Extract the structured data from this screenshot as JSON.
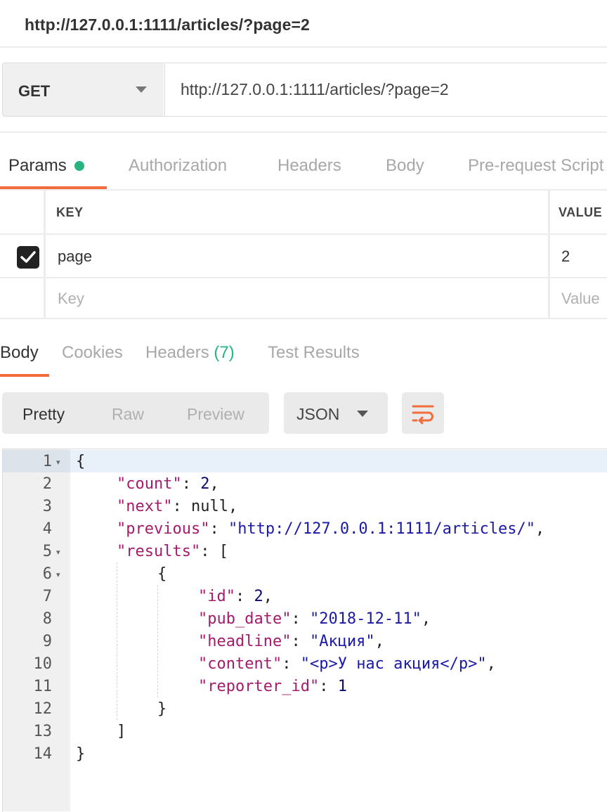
{
  "window": {
    "title": "http://127.0.0.1:1111/articles/?page=2"
  },
  "request": {
    "method": "GET",
    "url": "http://127.0.0.1:1111/articles/?page=2"
  },
  "request_tabs": [
    {
      "label": "Params",
      "active": true,
      "has_indicator": true
    },
    {
      "label": "Authorization",
      "active": false
    },
    {
      "label": "Headers",
      "active": false
    },
    {
      "label": "Body",
      "active": false
    },
    {
      "label": "Pre-request Script",
      "active": false
    }
  ],
  "params": {
    "headers": {
      "key": "KEY",
      "value": "VALUE"
    },
    "rows": [
      {
        "checked": true,
        "key": "page",
        "value": "2"
      }
    ],
    "placeholder": {
      "key": "Key",
      "value": "Value"
    }
  },
  "response_tabs": [
    {
      "label": "Body",
      "active": true
    },
    {
      "label": "Cookies",
      "active": false
    },
    {
      "label": "Headers",
      "count": "(7)",
      "active": false
    },
    {
      "label": "Test Results",
      "active": false
    }
  ],
  "view_modes": [
    {
      "label": "Pretty",
      "active": true
    },
    {
      "label": "Raw",
      "active": false
    },
    {
      "label": "Preview",
      "active": false
    }
  ],
  "format": {
    "selected": "JSON"
  },
  "icons": {
    "dropdown": "chevron-down-icon",
    "wrap": "wrap-lines-icon",
    "check": "check-icon"
  },
  "colors": {
    "accent": "#f26b3a",
    "indicator": "#26b47f",
    "json_key": "#a11d6c",
    "json_string": "#1a1aa6"
  },
  "code": {
    "line_numbers": [
      "1",
      "2",
      "3",
      "4",
      "5",
      "6",
      "7",
      "8",
      "9",
      "10",
      "11",
      "12",
      "13",
      "14"
    ],
    "lines": [
      {
        "indent": 0,
        "tokens": [
          {
            "t": "p",
            "v": "{"
          }
        ]
      },
      {
        "indent": 1,
        "tokens": [
          {
            "t": "k",
            "v": "\"count\""
          },
          {
            "t": "p",
            "v": ": "
          },
          {
            "t": "n",
            "v": "2"
          },
          {
            "t": "p",
            "v": ","
          }
        ]
      },
      {
        "indent": 1,
        "tokens": [
          {
            "t": "k",
            "v": "\"next\""
          },
          {
            "t": "p",
            "v": ": "
          },
          {
            "t": "p",
            "v": "null"
          },
          {
            "t": "p",
            "v": ","
          }
        ]
      },
      {
        "indent": 1,
        "tokens": [
          {
            "t": "k",
            "v": "\"previous\""
          },
          {
            "t": "p",
            "v": ": "
          },
          {
            "t": "s",
            "v": "\"http://127.0.0.1:1111/articles/\""
          },
          {
            "t": "p",
            "v": ","
          }
        ]
      },
      {
        "indent": 1,
        "tokens": [
          {
            "t": "k",
            "v": "\"results\""
          },
          {
            "t": "p",
            "v": ": ["
          }
        ]
      },
      {
        "indent": 2,
        "tokens": [
          {
            "t": "p",
            "v": "{"
          }
        ]
      },
      {
        "indent": 3,
        "tokens": [
          {
            "t": "k",
            "v": "\"id\""
          },
          {
            "t": "p",
            "v": ": "
          },
          {
            "t": "n",
            "v": "2"
          },
          {
            "t": "p",
            "v": ","
          }
        ]
      },
      {
        "indent": 3,
        "tokens": [
          {
            "t": "k",
            "v": "\"pub_date\""
          },
          {
            "t": "p",
            "v": ": "
          },
          {
            "t": "s",
            "v": "\"2018-12-11\""
          },
          {
            "t": "p",
            "v": ","
          }
        ]
      },
      {
        "indent": 3,
        "tokens": [
          {
            "t": "k",
            "v": "\"headline\""
          },
          {
            "t": "p",
            "v": ": "
          },
          {
            "t": "s",
            "v": "\"Акция\""
          },
          {
            "t": "p",
            "v": ","
          }
        ]
      },
      {
        "indent": 3,
        "tokens": [
          {
            "t": "k",
            "v": "\"content\""
          },
          {
            "t": "p",
            "v": ": "
          },
          {
            "t": "s",
            "v": "\"<p>У нас акция</p>\""
          },
          {
            "t": "p",
            "v": ","
          }
        ]
      },
      {
        "indent": 3,
        "tokens": [
          {
            "t": "k",
            "v": "\"reporter_id\""
          },
          {
            "t": "p",
            "v": ": "
          },
          {
            "t": "n",
            "v": "1"
          }
        ]
      },
      {
        "indent": 2,
        "tokens": [
          {
            "t": "p",
            "v": "}"
          }
        ]
      },
      {
        "indent": 1,
        "tokens": [
          {
            "t": "p",
            "v": "]"
          }
        ]
      },
      {
        "indent": 0,
        "tokens": [
          {
            "t": "p",
            "v": "}"
          }
        ]
      }
    ],
    "foldable_lines": [
      "1",
      "5",
      "6"
    ]
  }
}
